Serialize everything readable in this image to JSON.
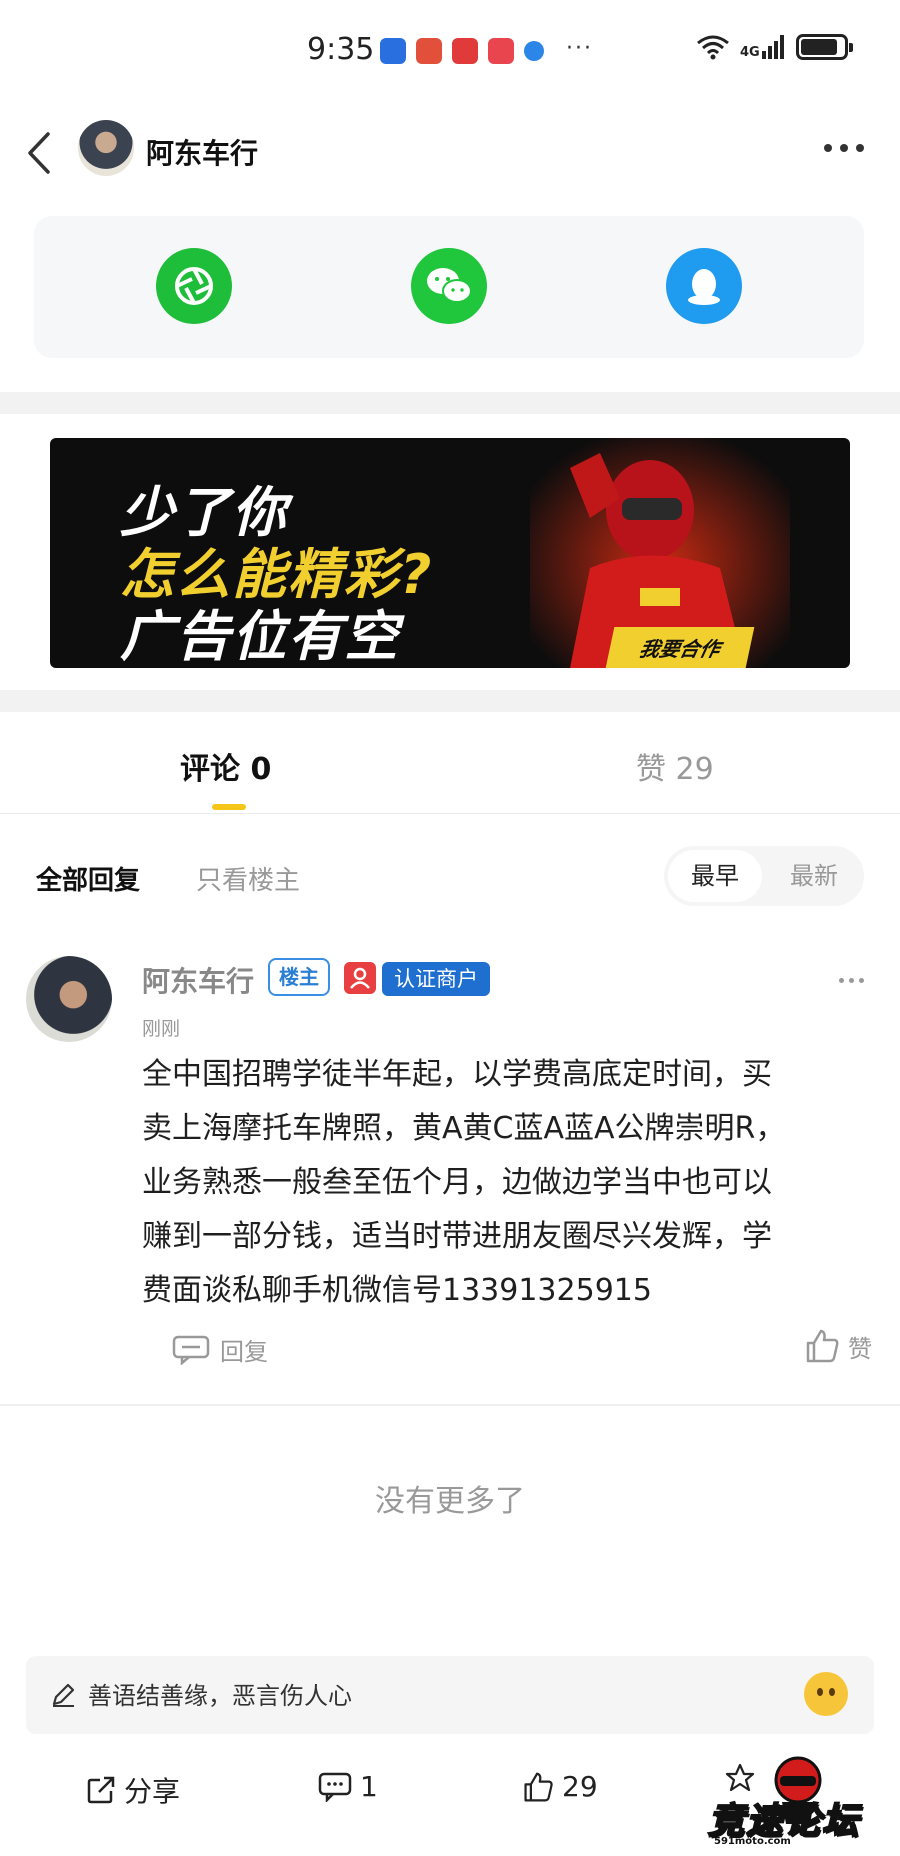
{
  "status_bar": {
    "time": "9:35",
    "network": "4G",
    "signal_label": "6",
    "battery_level": 0.85
  },
  "header": {
    "title": "阿东车行"
  },
  "banner": {
    "line1": "少了你",
    "line2": "怎么能精彩?",
    "line3": "广告位有空",
    "cta": "我要合作"
  },
  "tabs": {
    "comments": "评论 0",
    "likes": "赞 29"
  },
  "filters": {
    "all": "全部回复",
    "op_only": "只看楼主",
    "sort_earliest": "最早",
    "sort_latest": "最新"
  },
  "comment": {
    "author": "阿东车行",
    "badge_op": "楼主",
    "badge_verified": "认证商户",
    "time": "刚刚",
    "lines": [
      "全中国招聘学徒半年起，以学费高底定时间，买",
      "卖上海摩托车牌照，黄A黄C蓝A蓝A公牌崇明R，",
      "业务熟悉一般叁至伍个月，边做边学当中也可以",
      "赚到一部分钱，适当时带进朋友圈尽兴发辉，学",
      "费面谈私聊手机微信号13391325915"
    ],
    "reply_label": "回复",
    "like_label": "赞"
  },
  "no_more": "没有更多了",
  "bottom": {
    "input_placeholder": "善语结善缘，恶言伤人心",
    "share_label": "分享",
    "comment_count": "1",
    "like_count": "29"
  },
  "watermark": {
    "text": "竞速论坛",
    "sub": "591moto.com"
  },
  "colors": {
    "accent": "#f5c518",
    "moments_green": "#1fbe3a",
    "wechat_green": "#20c63c",
    "qq_blue": "#1f9bf0",
    "verified_blue": "#1f6fd1"
  }
}
